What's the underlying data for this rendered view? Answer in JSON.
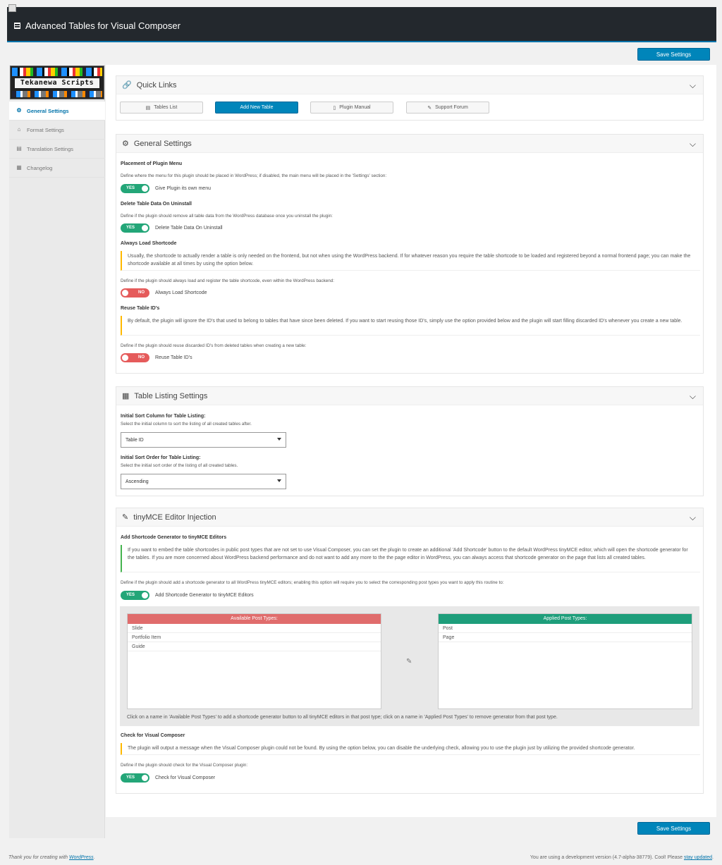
{
  "app": {
    "title": "Advanced Tables for Visual Composer"
  },
  "toolbar": {
    "save_label": "Save Settings"
  },
  "logo": {
    "text": "Tekanewa Scripts"
  },
  "sidebar": {
    "items": [
      {
        "label": "General Settings",
        "icon": "gear-icon",
        "active": true
      },
      {
        "label": "Format Settings",
        "icon": "home-icon",
        "active": false
      },
      {
        "label": "Translation Settings",
        "icon": "translate-icon",
        "active": false
      },
      {
        "label": "Changelog",
        "icon": "document-icon",
        "active": false
      }
    ]
  },
  "quick_links": {
    "title": "Quick Links",
    "buttons": [
      {
        "label": "Tables List",
        "icon": "list-icon"
      },
      {
        "label": "Add New Table",
        "icon": ""
      },
      {
        "label": "Plugin Manual",
        "icon": "document-icon"
      },
      {
        "label": "Support Forum",
        "icon": "wrench-icon"
      }
    ]
  },
  "general": {
    "title": "General Settings",
    "placement_label": "Placement of Plugin Menu",
    "placement_desc": "Define where the menu for this plugin should be placed in WordPress; if disabled, the main menu will be placed in the 'Settings' section:",
    "placement_toggle": {
      "state": "YES",
      "label": "Give Plugin its own menu"
    },
    "delete_label": "Delete Table Data On Uninstall",
    "delete_desc": "Define if the plugin should remove all table data from the WordPress database once you uninstall the plugin:",
    "delete_toggle": {
      "state": "YES",
      "label": "Delete Table Data On Uninstall"
    },
    "always_label": "Always Load Shortcode",
    "always_note": "Usually, the shortcode to actually render a table is only needed on the frontend, but not when using the WordPress backend. If for whatever reason you require the table shortcode to be loaded and registered beyond a normal frontend page; you can make the shortcode available at all times by using the option below.",
    "always_desc": "Define if the plugin should always load and register the table shortcode, even within the WordPress backend:",
    "always_toggle": {
      "state": "NO",
      "label": "Always Load Shortcode"
    },
    "reuse_label": "Reuse Table ID's",
    "reuse_note": "By default, the plugin will ignore the ID's that used to belong to tables that have since been deleted. If you want to start reusing those ID's, simply use the option provided below and the plugin will start filling discarded ID's whenever you create a new table.",
    "reuse_desc": "Define if the plugin should reuse discarded ID's from deleted tables when creating a new table:",
    "reuse_toggle": {
      "state": "NO",
      "label": "Reuse Table ID's"
    }
  },
  "listing": {
    "title": "Table Listing Settings",
    "sort_col_label": "Initial Sort Column for Table Listing:",
    "sort_col_desc": "Select the initial column to sort the listing of all created tables after.",
    "sort_col_value": "Table ID",
    "sort_order_label": "Initial Sort Order for Table Listing:",
    "sort_order_desc": "Select the initial sort order of the listing of all created tables.",
    "sort_order_value": "Ascending"
  },
  "tinymce": {
    "title": "tinyMCE Editor Injection",
    "gen_label": "Add Shortcode Generator to tinyMCE Editors",
    "gen_note": "If you want to embed the table shortcodes in public post types that are not set to use Visual Composer, you can set the plugin to create an additional 'Add Shortcode' button to the default WordPress tinyMCE editor, which will open the shortcode generator for the tables. If you are more concerned about WordPress backend performance and do not want to add any more to the the page editor in WordPress, you can always access that shortcode generator on the page that lists all created tables.",
    "gen_desc": "Define if the plugin should add a shortcode generator to all WordPress tinyMCE editors; enabling this option will require you to select the corresponding post types you want to apply this routine to:",
    "gen_toggle": {
      "state": "YES",
      "label": "Add Shortcode Generator to tinyMCE Editors"
    },
    "available_title": "Available Post Types:",
    "available": [
      "Slide",
      "Portfolio Item",
      "Guide"
    ],
    "applied_title": "Applied Post Types:",
    "applied": [
      "Post",
      "Page"
    ],
    "help": "Click on a name in 'Available Post Types' to add a shortcode generator button to all tinyMCE editors in that post type; click on a name in 'Applied Post Types' to remove generator from that post type.",
    "vc_label": "Check for Visual Composer",
    "vc_note": "The plugin will output a message when the Visual Composer plugin could not be found. By using the option below, you can disable the underlying check, allowing you to use the plugin just by utilizing the provided shortcode generator.",
    "vc_desc": "Define if the plugin should check for the Visual Composer plugin:",
    "vc_toggle": {
      "state": "YES",
      "label": "Check for Visual Composer"
    }
  },
  "footer": {
    "left_prefix": "Thank you for creating with ",
    "left_link": "WordPress",
    "left_suffix": ".",
    "right_prefix": "You are using a development version (4.7-alpha-38779). Cool! Please ",
    "right_link": "stay updated",
    "right_suffix": "."
  },
  "colors": {
    "accent": "#0085ba",
    "admin_bar": "#23282d",
    "toggle_on": "#23a678",
    "toggle_off": "#e55b5b",
    "available_head": "#e06c6c",
    "applied_head": "#1e9e7b"
  }
}
